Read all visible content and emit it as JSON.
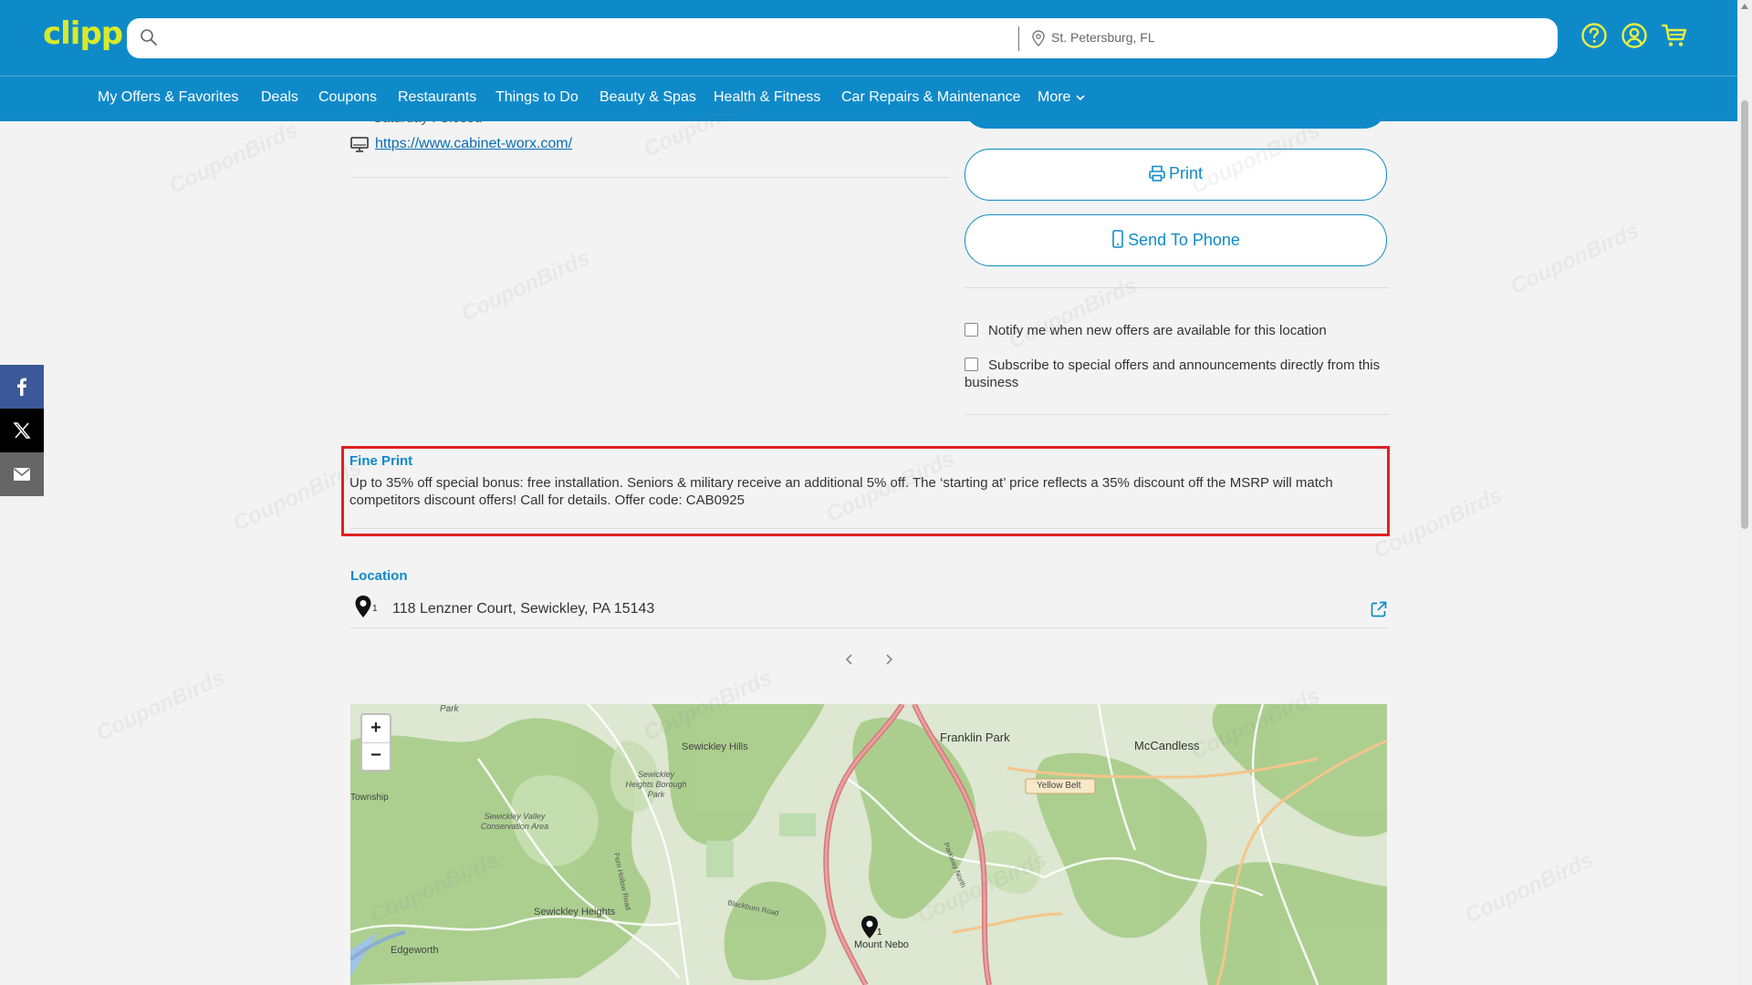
{
  "header": {
    "logo": "clipp",
    "search": {
      "placeholder": "",
      "location": "St. Petersburg, FL"
    },
    "icons": [
      "help-icon",
      "account-icon",
      "cart-icon"
    ],
    "nav": [
      "My Offers & Favorites",
      "Deals",
      "Coupons",
      "Restaurants",
      "Things to Do",
      "Beauty & Spas",
      "Health & Fitness",
      "Car Repairs & Maintenance",
      "More"
    ]
  },
  "details": {
    "hours_partial": "Saturday : Closed",
    "website": "https://www.cabinet-worx.com/"
  },
  "actions": {
    "print": "Print",
    "send_to_phone": "Send To Phone"
  },
  "subscriptions": {
    "notify": "Notify me when new offers are available for this location",
    "subscribe": "Subscribe to special offers and announcements directly from this business"
  },
  "fine_print": {
    "title": "Fine Print",
    "text": "Up to 35% off special bonus: free installation. Seniors & military receive an additional 5% off. The ‘starting at’ price reflects a 35% discount off the MSRP will match competitors discount offers! Call for details. Offer code: CAB0925"
  },
  "location": {
    "title": "Location",
    "marker_number": "1",
    "address": "118 Lenzner Court, Sewickley, PA 15143"
  },
  "map": {
    "labels": {
      "park": "Park",
      "sewickley_hills": "Sewickley Hills",
      "franklin_park": "Franklin Park",
      "mccandless": "McCandless",
      "yellow_belt": "Yellow Belt",
      "borough_park": "Sewickley Heights Borough Park",
      "township": "Township",
      "conservation": "Sewickley Valley Conservation Area",
      "sewickley_heights": "Sewickley Heights",
      "edgeworth": "Edgeworth",
      "mount_nebo": "Mount Nebo",
      "blackburn_road": "Blackburn Road",
      "parkway_north": "Parkway North",
      "fern_hollow": "Fern Hollow Road",
      "marker_number": "1"
    },
    "zoom_in": "+",
    "zoom_out": "−"
  },
  "watermark": "CouponBirds",
  "colors": {
    "brand": "#0f8ac9",
    "logo": "#d9ea2a",
    "highlight": "#e02020"
  }
}
